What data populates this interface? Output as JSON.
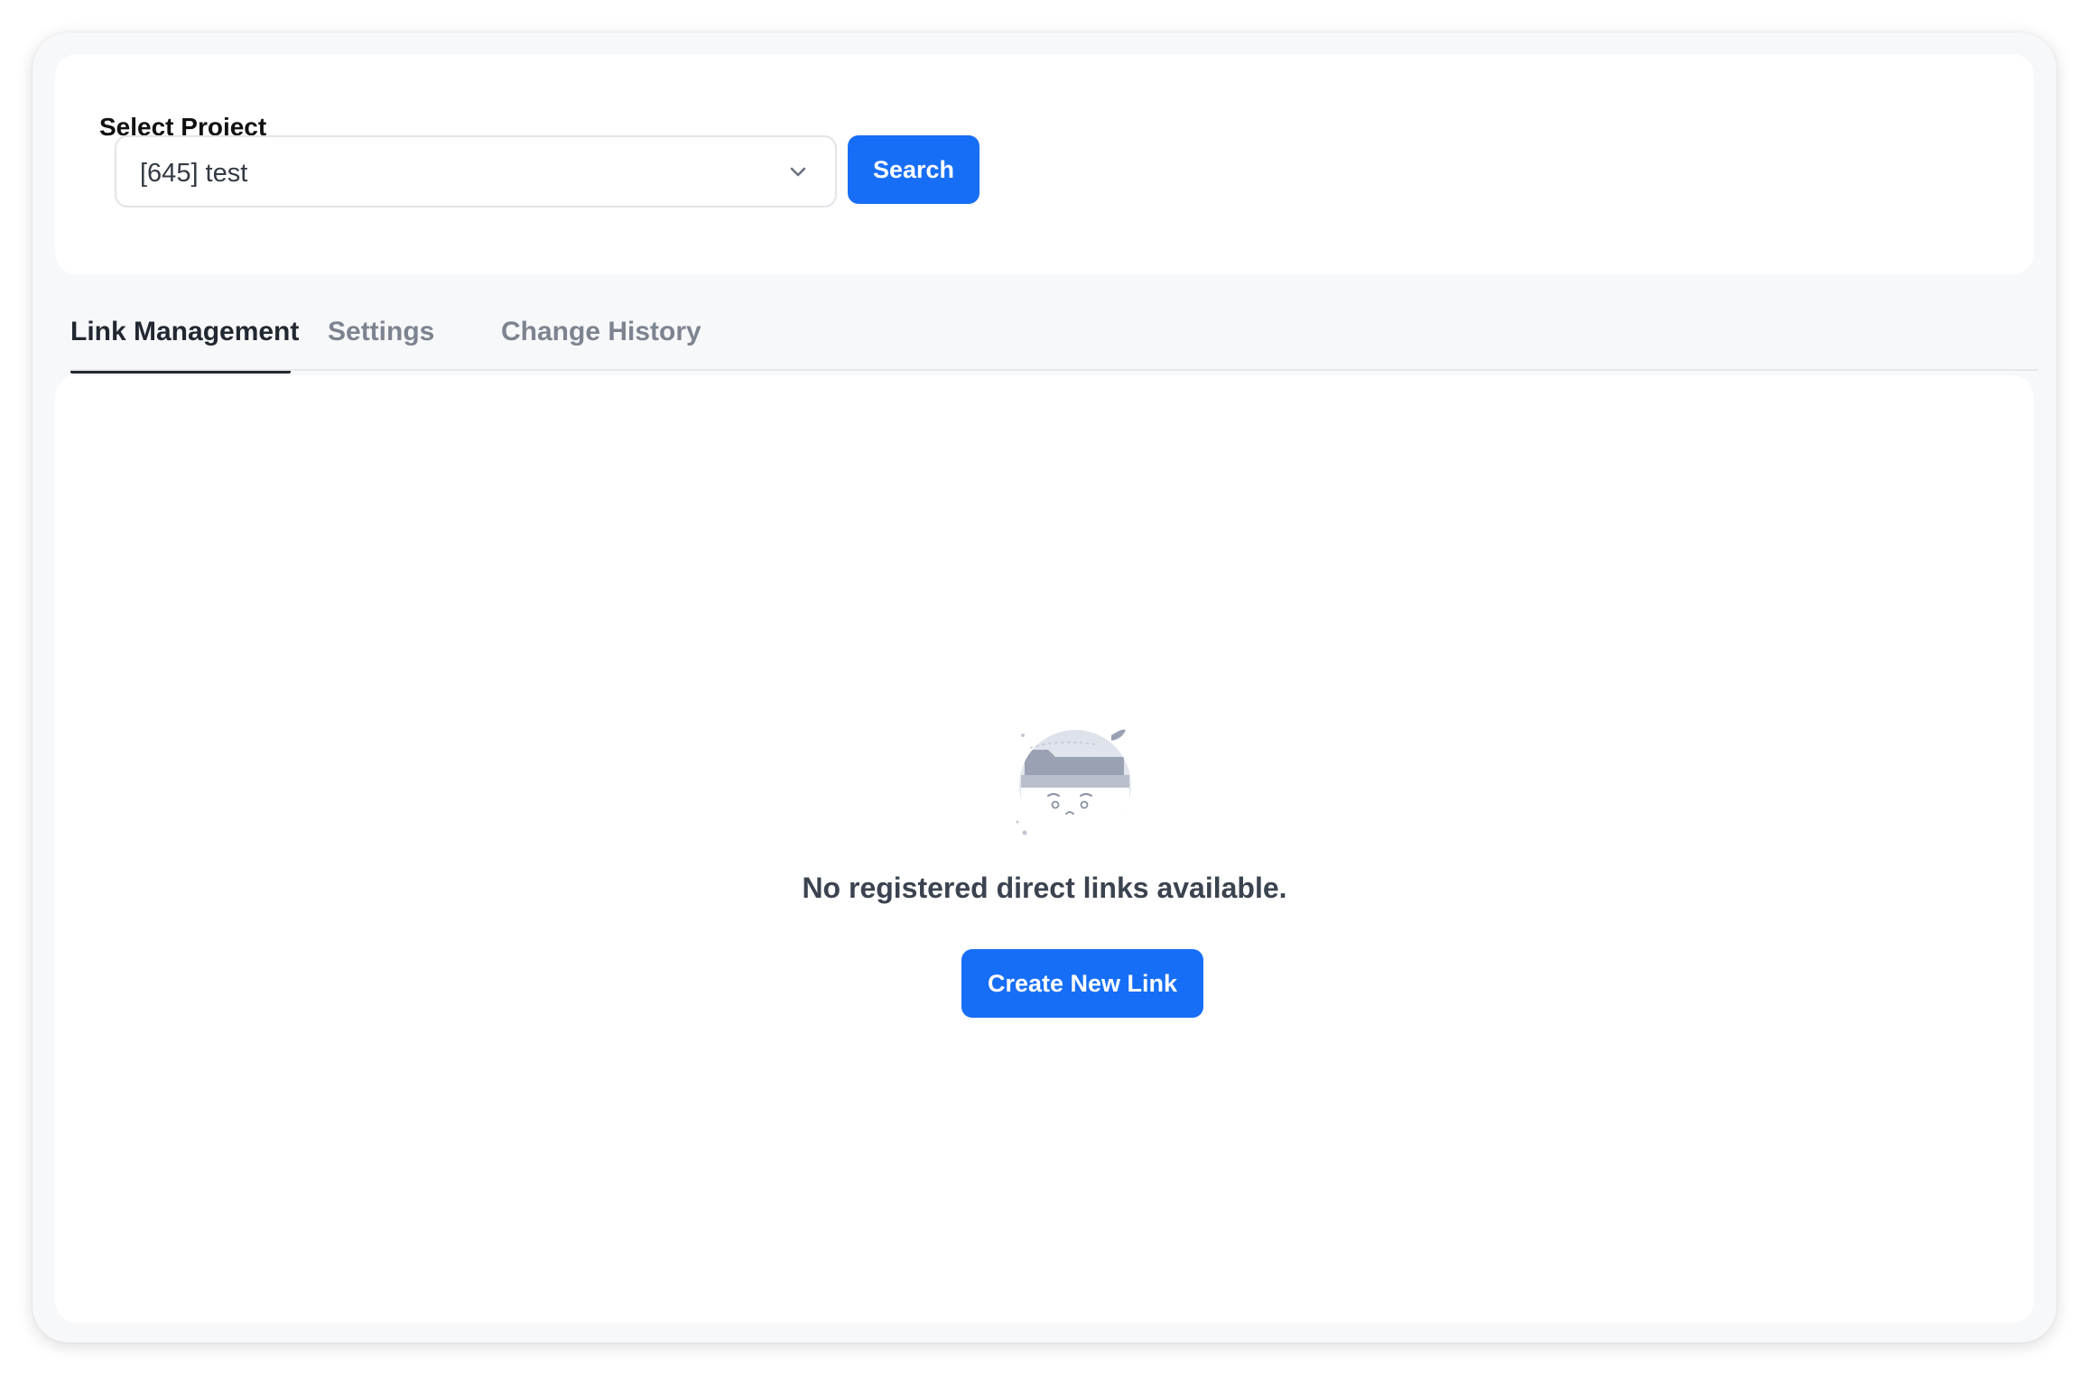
{
  "project_picker": {
    "label": "Select Project",
    "selected_value": "[645] test",
    "search_label": "Search"
  },
  "tabs": [
    {
      "label": "Link Management",
      "active": true
    },
    {
      "label": "Settings",
      "active": false
    },
    {
      "label": "Change History",
      "active": false
    }
  ],
  "empty_state": {
    "message": "No registered direct links available.",
    "create_label": "Create New Link",
    "icon": "empty-folder-icon"
  },
  "colors": {
    "accent": "#176ef6",
    "active_tab": "#222831",
    "inactive_tab": "#7d8490"
  }
}
